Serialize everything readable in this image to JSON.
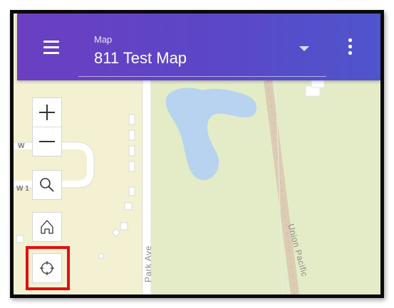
{
  "header": {
    "menu_icon": "hamburger-menu-icon",
    "map_select": {
      "label": "Map",
      "value": "811 Test Map"
    },
    "more_icon": "more-vertical-icon",
    "gradient_start": "#6b3fc1",
    "gradient_end": "#4f55cc"
  },
  "map": {
    "labels": {
      "street_1": "Park Ave",
      "railway": "Union Pacific",
      "road_w_1": "W",
      "road_w_2": "W 1"
    },
    "colors": {
      "land": "#f3f1d2",
      "park": "#e3ecc6",
      "water": "#b7d3ef",
      "road": "#ffffff",
      "railway": "#d9c8b0"
    }
  },
  "controls": {
    "zoom_in_icon": "plus-icon",
    "zoom_out_icon": "minus-icon",
    "search_icon": "search-icon",
    "home_icon": "home-icon",
    "locate_icon": "locate-crosshair-icon",
    "highlight_color": "#e01010"
  }
}
